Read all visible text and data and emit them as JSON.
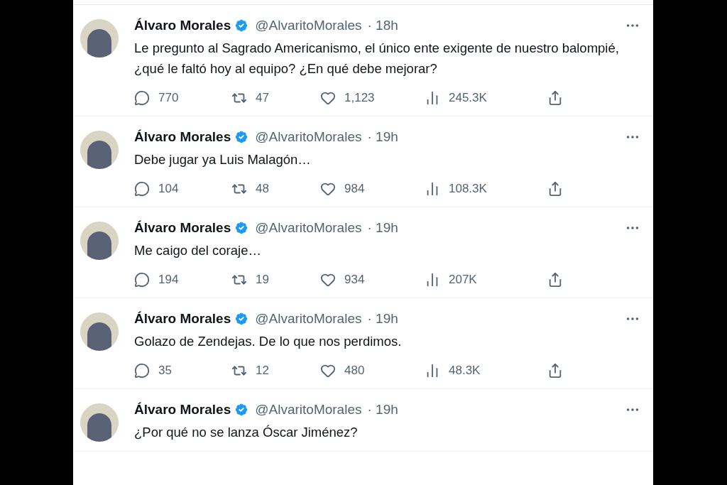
{
  "tweets": [
    {
      "name": "Álvaro Morales",
      "handle": "@AlvaritoMorales",
      "time": "· 18h",
      "text": "Le pregunto al Sagrado Americanismo, el único ente exigente de nuestro balompié, ¿qué le faltó hoy al equipo? ¿En qué debe mejorar?",
      "replies": "770",
      "retweets": "47",
      "likes": "1,123",
      "views": "245.3K"
    },
    {
      "name": "Álvaro Morales",
      "handle": "@AlvaritoMorales",
      "time": "· 19h",
      "text": "Debe jugar ya Luis Malagón…",
      "replies": "104",
      "retweets": "48",
      "likes": "984",
      "views": "108.3K"
    },
    {
      "name": "Álvaro Morales",
      "handle": "@AlvaritoMorales",
      "time": "· 19h",
      "text": "Me caigo del coraje…",
      "replies": "194",
      "retweets": "19",
      "likes": "934",
      "views": "207K"
    },
    {
      "name": "Álvaro Morales",
      "handle": "@AlvaritoMorales",
      "time": "· 19h",
      "text": "Golazo de Zendejas. De lo que nos perdimos.",
      "replies": "35",
      "retweets": "12",
      "likes": "480",
      "views": "48.3K"
    },
    {
      "name": "Álvaro Morales",
      "handle": "@AlvaritoMorales",
      "time": "· 19h",
      "text": "¿Por qué no se lanza Óscar Jiménez?"
    }
  ]
}
